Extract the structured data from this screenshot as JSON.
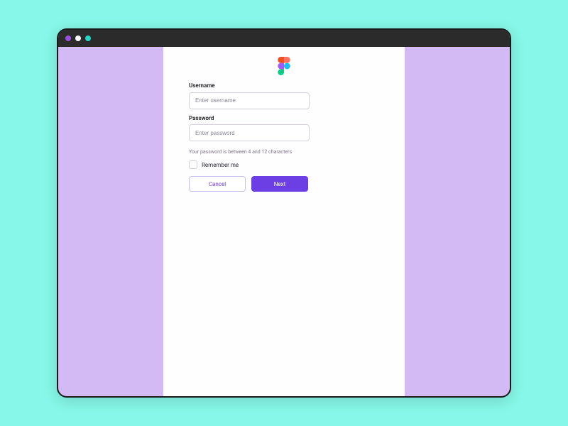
{
  "form": {
    "username_label": "Username",
    "username_placeholder": "Enter username",
    "password_label": "Password",
    "password_placeholder": "Enter password",
    "password_hint": "Your password is between 4 and 12 characters",
    "remember_label": "Remember me",
    "cancel_label": "Cancel",
    "next_label": "Next"
  },
  "colors": {
    "accent": "#6b3fe4",
    "page_bg": "#d3baf5",
    "outer_bg": "#86f7e8"
  }
}
